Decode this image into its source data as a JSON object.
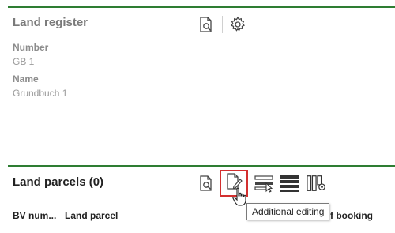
{
  "register": {
    "title": "Land register",
    "fields": [
      {
        "label": "Number",
        "value": "GB 1"
      },
      {
        "label": "Name",
        "value": "Grundbuch 1"
      }
    ],
    "toolbar": [
      {
        "icon": "document-search-icon"
      },
      {
        "icon": "gear-icon"
      }
    ]
  },
  "parcels": {
    "title": "Land parcels (0)",
    "toolbar": [
      {
        "icon": "document-search-icon"
      },
      {
        "icon": "document-edit-icon",
        "highlighted": true
      },
      {
        "icon": "select-rows-icon"
      },
      {
        "icon": "list-view-icon"
      },
      {
        "icon": "column-settings-icon"
      }
    ],
    "columns": [
      "BV num...",
      "Land parcel",
      "f booking"
    ]
  },
  "tooltip": "Additional editing",
  "colors": {
    "accent": "#2e7d32",
    "highlight": "#d32f2f"
  }
}
